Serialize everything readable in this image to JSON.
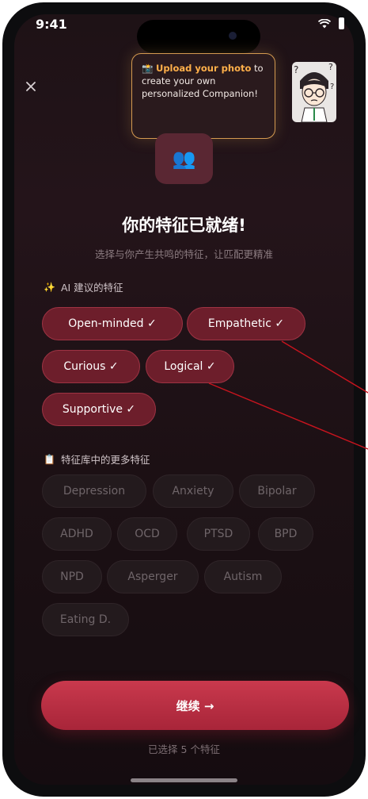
{
  "status_bar": {
    "time": "9:41"
  },
  "tooltip": {
    "emoji": "📸",
    "highlight": "Upload your photo",
    "rest": " to create your own personalized Companion!"
  },
  "hero_emoji": "👥",
  "heading": "你的特征已就绪!",
  "subheading": "选择与你产生共鸣的特征，让匹配更精准",
  "ai_section": {
    "icon": "✨",
    "title": "AI 建议的特征"
  },
  "suggested_traits": [
    "Open-minded ✓",
    "Empathetic ✓",
    "Curious ✓",
    "Logical ✓",
    "Supportive ✓"
  ],
  "library_section": {
    "icon": "📋",
    "title": "特征库中的更多特征"
  },
  "library_traits": [
    "Depression",
    "Anxiety",
    "Bipolar",
    "ADHD",
    "OCD",
    "PTSD",
    "BPD",
    "NPD",
    "Asperger",
    "Autism",
    "Eating D."
  ],
  "continue_button": "继续 →",
  "selected_count": "已选择 5 个特征",
  "colors": {
    "accent": "#a82539",
    "chip_selected": "#6d1e2b",
    "tooltip_border": "#d49a50"
  },
  "icons": {
    "close": "close-icon",
    "wifi": "wifi-icon",
    "battery": "battery-icon"
  }
}
